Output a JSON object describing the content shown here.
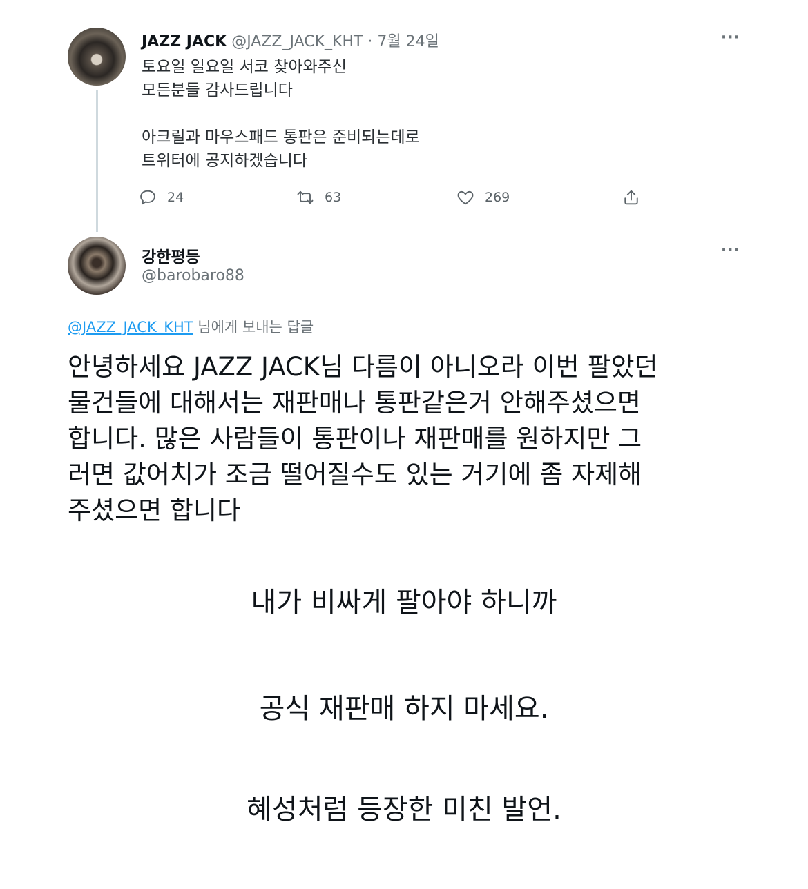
{
  "tweet1": {
    "display_name": "JAZZ JACK",
    "handle_date": "@JAZZ_JACK_KHT · 7월 24일",
    "more": "···",
    "body_lines_a": [
      "토요일 일요일 서코 찾아와주신",
      "모든분들 감사드립니다"
    ],
    "body_lines_b": [
      "아크릴과 마우스패드 통판은 준비되는데로",
      "트위터에 공지하겠습니다"
    ],
    "counts": {
      "replies": "24",
      "retweets": "63",
      "likes": "269"
    }
  },
  "tweet2": {
    "display_name": "강한평등",
    "handle": "@barobaro88",
    "more": "···",
    "reply_mention": "@JAZZ_JACK_KHT",
    "reply_suffix": " 님에게 보내는 답글",
    "body_lines": [
      "안녕하세요 JAZZ JACK님 다름이 아니오라 이번 팔았던",
      "물건들에 대해서는 재판매나 통판같은거 안해주셨으면",
      "합니다. 많은 사람들이 통판이나 재판매를 원하지만 그",
      "러면 값어치가 조금 떨어질수도 있는 거기에 좀 자제해",
      "주셨으면 합니다"
    ]
  },
  "captions": [
    "내가 비싸게 팔아야 하니까",
    "공식 재판매 하지 마세요.",
    "혜성처럼 등장한 미친 발언."
  ],
  "icons": {
    "reply": "speech-bubble-icon",
    "retweet": "retweet-icon",
    "like": "heart-icon",
    "share": "share-upload-icon"
  },
  "colors": {
    "mention": "#1d9bf0",
    "secondary_text": "#6b7378",
    "thread_line": "#cfd9de"
  }
}
